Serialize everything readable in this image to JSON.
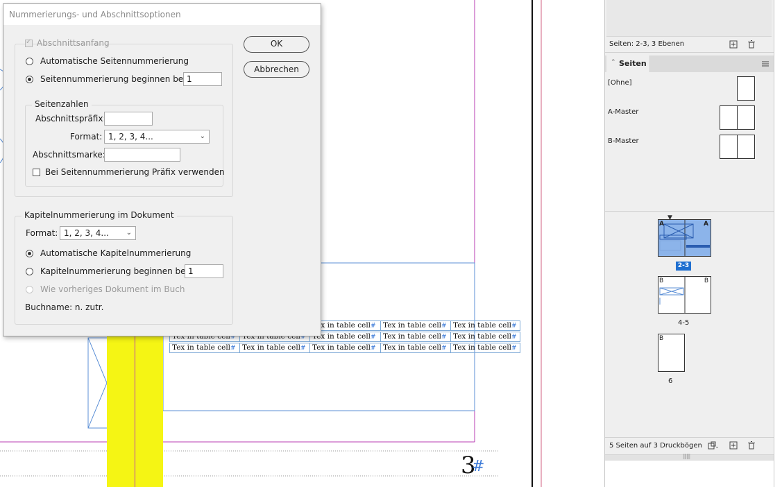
{
  "canvas": {
    "table_cell_text": "Tex in table cell",
    "rows": [
      [
        "Tex in table cell",
        "Tex in table cell",
        "Tex in table cell",
        "Tex in table cell",
        "Tex in table cell"
      ],
      [
        "Tex in table cell",
        "Tex in table cell",
        "Tex in table cell",
        "Tex in table cell",
        "Tex in table cell"
      ],
      [
        "Tex in table cell",
        "Tex in table cell",
        "Tex in table cell",
        "Tex in table cell",
        "Tex in table cell"
      ]
    ],
    "page_number": "3",
    "page_number_marker": "#",
    "colors": {
      "highlight": "#f5f514",
      "frame": "#b93cb3",
      "guide": "#5b8fd6"
    }
  },
  "dialog": {
    "title": "Nummerierungs- und Abschnittsoptionen",
    "section_start_label": "Abschnittsanfang",
    "auto_page_numbering": "Automatische Seitennummerierung",
    "start_page_numbering": "Seitennummerierung beginnen bei:",
    "start_page_value": "1",
    "page_numbers_group": "Seitenzahlen",
    "section_prefix_label": "Abschnittspräfix:",
    "section_prefix_value": "",
    "format_label": "Format:",
    "format_value": "1, 2, 3, 4...",
    "section_marker_label": "Abschnittsmarke:",
    "section_marker_value": "",
    "use_prefix_label": "Bei Seitennummerierung Präfix verwenden",
    "chapter_group": "Kapitelnummerierung im Dokument",
    "chapter_format_label": "Format:",
    "chapter_format_value": "1, 2, 3, 4...",
    "auto_chapter_numbering": "Automatische Kapitelnummerierung",
    "start_chapter_numbering": "Kapitelnummerierung beginnen bei:",
    "start_chapter_value": "1",
    "same_as_previous": "Wie vorheriges Dokument im Buch",
    "book_name": "Buchname: n. zutr.",
    "ok_label": "OK",
    "cancel_label": "Abbrechen"
  },
  "panel": {
    "layers_status": "Seiten: 2-3, 3 Ebenen",
    "tab_label": "Seiten",
    "masters": [
      {
        "name": "[Ohne]"
      },
      {
        "name": "A-Master"
      },
      {
        "name": "B-Master"
      }
    ],
    "spreads": [
      {
        "label": "2-3",
        "left_prefix": "A",
        "right_prefix": "A",
        "selected": true
      },
      {
        "label": "4-5",
        "left_prefix": "B",
        "right_prefix": "B",
        "selected": false
      },
      {
        "label": "6",
        "left_prefix": "B",
        "selected": false
      }
    ],
    "footer_status": "5 Seiten auf 3 Druckbögen",
    "icons": [
      "new-page-icon",
      "trash-icon",
      "panel-menu-icon",
      "edit-size-icon"
    ]
  }
}
